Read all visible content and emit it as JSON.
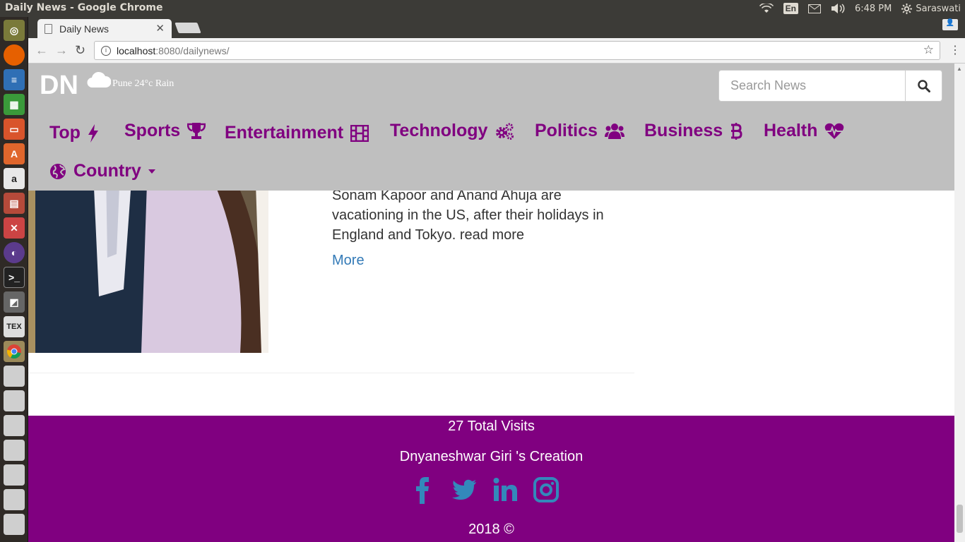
{
  "os": {
    "window_title": "Daily News - Google Chrome",
    "keyboard_lang": "En",
    "clock": "6:48 PM",
    "user": "Saraswati"
  },
  "browser": {
    "tab_title": "Daily News",
    "url_host": "localhost",
    "url_path": ":8080/dailynews/"
  },
  "site": {
    "logo": "DN",
    "weather": "Pune 24°c Rain",
    "search_placeholder": "Search News",
    "nav": [
      {
        "label": "Top",
        "icon": "bolt-icon"
      },
      {
        "label": "Sports",
        "icon": "trophy-icon"
      },
      {
        "label": "Entertainment",
        "icon": "film-icon"
      },
      {
        "label": "Technology",
        "icon": "cogs-icon"
      },
      {
        "label": "Politics",
        "icon": "users-icon"
      },
      {
        "label": "Business",
        "icon": "bitcoin-icon"
      },
      {
        "label": "Health",
        "icon": "heartbeat-icon"
      },
      {
        "label": "Country",
        "icon": "globe-icon"
      }
    ],
    "accent_color": "#800080"
  },
  "article": {
    "summary": "Sonam Kapoor and Anand Ahuja are vacationing in the US, after their holidays in England and Tokyo. read more",
    "more_label": "More"
  },
  "footer": {
    "visits": "27 Total Visits",
    "creator": "Dnyaneshwar Giri 's Creation",
    "social": [
      "facebook-icon",
      "twitter-icon",
      "linkedin-icon",
      "instagram-icon"
    ],
    "copyright": "2018 ©"
  }
}
